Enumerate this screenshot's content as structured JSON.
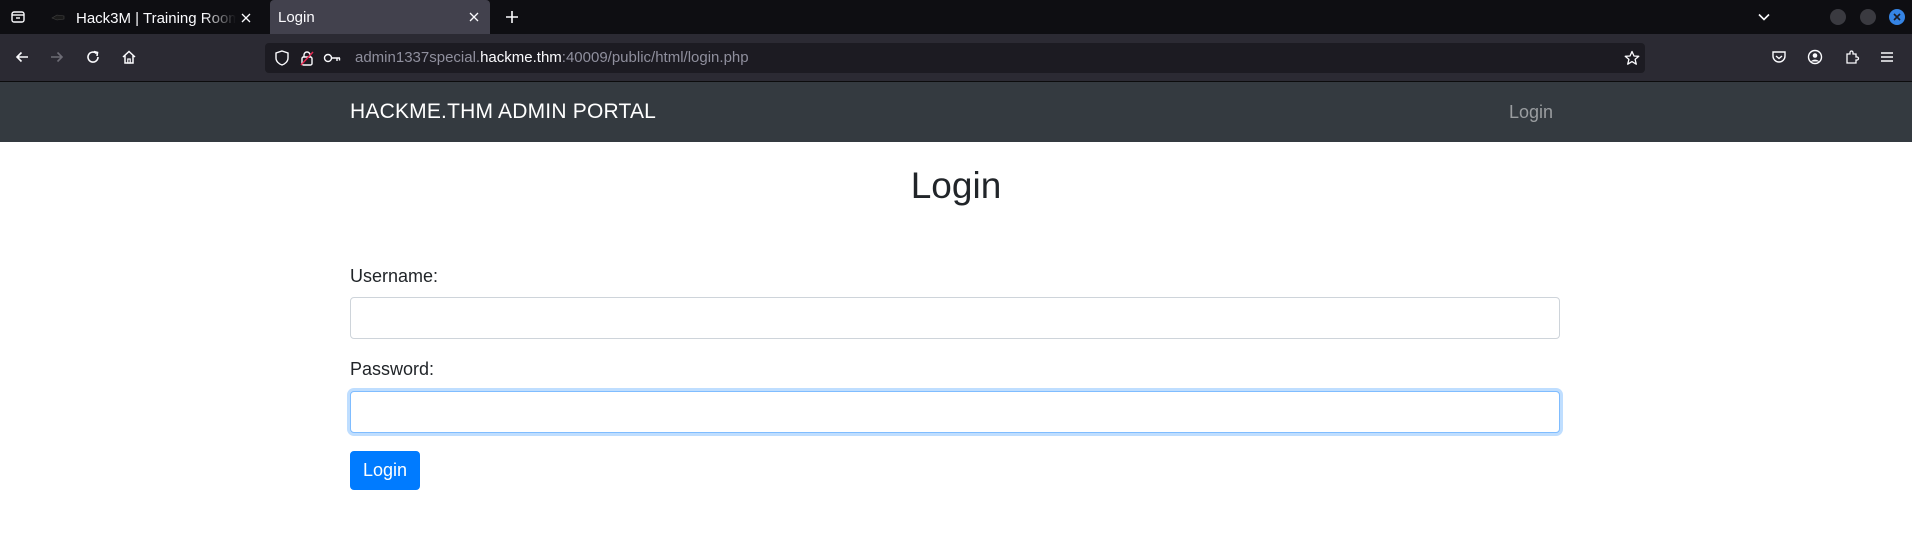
{
  "browser": {
    "tabs": [
      {
        "title": "Hack3M | Training Room .",
        "active": false
      },
      {
        "title": "Login",
        "active": true
      }
    ],
    "url": {
      "prefix": "admin1337special.",
      "host": "hackme.thm",
      "suffix": ":40009/public/html/login.php"
    }
  },
  "site": {
    "brand": "HACKME.THM ADMIN PORTAL",
    "nav_login": "Login"
  },
  "form": {
    "title": "Login",
    "username_label": "Username:",
    "username_value": "",
    "password_label": "Password:",
    "password_value": "",
    "submit_label": "Login"
  },
  "colors": {
    "navbar_bg": "#343a40",
    "primary": "#007bff",
    "focus_border": "#80bdff",
    "browser_chrome": "#2b2a33",
    "tabstrip": "#0e0e12"
  }
}
